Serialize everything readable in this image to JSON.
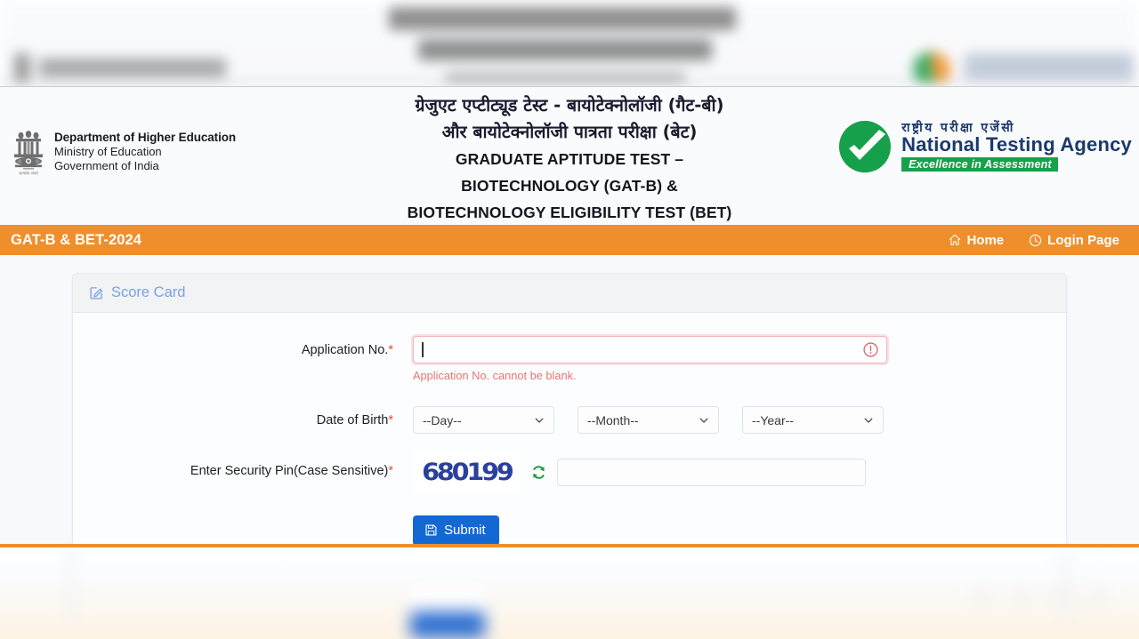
{
  "header": {
    "left_brand": {
      "emblem_icon": "india-state-emblem-icon",
      "line1": "Department of Higher Education",
      "line2": "Ministry of Education",
      "line3": "Government of India"
    },
    "title": {
      "hindi_line1": "ग्रेजुएट एप्टीट्यूड टेस्ट - बायोटेक्नोलॉजी (गैट-बी)",
      "hindi_line2": "और बायोटेक्नोलॉजी पात्रता परीक्षा (बेट)",
      "english_line1": "GRADUATE APTITUDE TEST –",
      "english_line2": "BIOTECHNOLOGY (GAT-B) &",
      "english_line3": "BIOTECHNOLOGY ELIGIBILITY TEST (BET)"
    },
    "right_brand": {
      "logo_icon": "nta-swoosh-logo-icon",
      "hindi": "राष्ट्रीय परीक्षा एजेंसी",
      "english": "National Testing Agency",
      "tagline": "Excellence in Assessment",
      "tagline_bg": "#16a14a"
    }
  },
  "navbar": {
    "brand": "GAT-B & BET-2024",
    "bg_color": "#ef8f2c",
    "links": [
      {
        "label": "Home",
        "icon": "home-icon"
      },
      {
        "label": "Login Page",
        "icon": "clock-icon"
      }
    ]
  },
  "card": {
    "header_icon": "edit-square-icon",
    "header_title": "Score Card",
    "header_title_color": "#7aa0ea"
  },
  "form": {
    "application_no": {
      "label": "Application No.",
      "required_mark": "*",
      "value": "",
      "placeholder": "",
      "error": "Application No. cannot be blank.",
      "error_color": "#e8766f",
      "border_color": "#f0b5b9",
      "error_icon": "exclamation-circle-icon",
      "has_caret": true
    },
    "date_of_birth": {
      "label": "Date of Birth",
      "required_mark": "*",
      "day": {
        "selected": "--Day--"
      },
      "month": {
        "selected": "--Month--"
      },
      "year": {
        "selected": "--Year--"
      }
    },
    "security_pin": {
      "label": "Enter Security Pin(Case Sensitive)",
      "required_mark": "*",
      "captcha_text": "680199",
      "captcha_color": "#2a3f9e",
      "refresh_icon": "refresh-icon",
      "refresh_color": "#16a14a",
      "value": "",
      "placeholder": ""
    },
    "submit": {
      "label": "Submit",
      "icon": "save-icon",
      "bg_color": "#1468d4"
    }
  }
}
